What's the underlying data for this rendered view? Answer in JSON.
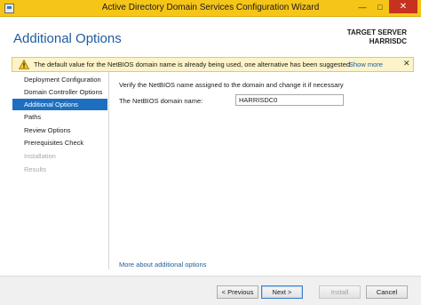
{
  "window": {
    "title": "Active Directory Domain Services Configuration Wizard",
    "minimize_glyph": "—",
    "maximize_glyph": "□",
    "close_glyph": "✕"
  },
  "header": {
    "page_title": "Additional Options",
    "target_label": "TARGET SERVER",
    "target_name": "HARRISDC"
  },
  "banner": {
    "message": "The default value for the NetBIOS domain name is already being used, one alternative has been suggested.",
    "show_more": "Show more",
    "close_glyph": "✕",
    "icon": "warning-icon",
    "color": "#fcf3c8"
  },
  "nav": {
    "items": [
      {
        "label": "Deployment Configuration",
        "state": "normal"
      },
      {
        "label": "Domain Controller Options",
        "state": "normal"
      },
      {
        "label": "Additional Options",
        "state": "active"
      },
      {
        "label": "Paths",
        "state": "normal"
      },
      {
        "label": "Review Options",
        "state": "normal"
      },
      {
        "label": "Prerequisites Check",
        "state": "normal"
      },
      {
        "label": "Installation",
        "state": "disabled"
      },
      {
        "label": "Results",
        "state": "disabled"
      }
    ],
    "active_color": "#1e6fc0"
  },
  "main": {
    "instruction": "Verify the NetBIOS name assigned to the domain and change it if necessary",
    "netbios_label": "The NetBIOS domain name:",
    "netbios_value": "HARRISDC0",
    "more_link": "More about additional options"
  },
  "footer": {
    "previous": "< Previous",
    "next": "Next >",
    "install": "Install",
    "cancel": "Cancel"
  },
  "colors": {
    "title_bar": "#f5c518",
    "accent": "#1e5b9e"
  }
}
